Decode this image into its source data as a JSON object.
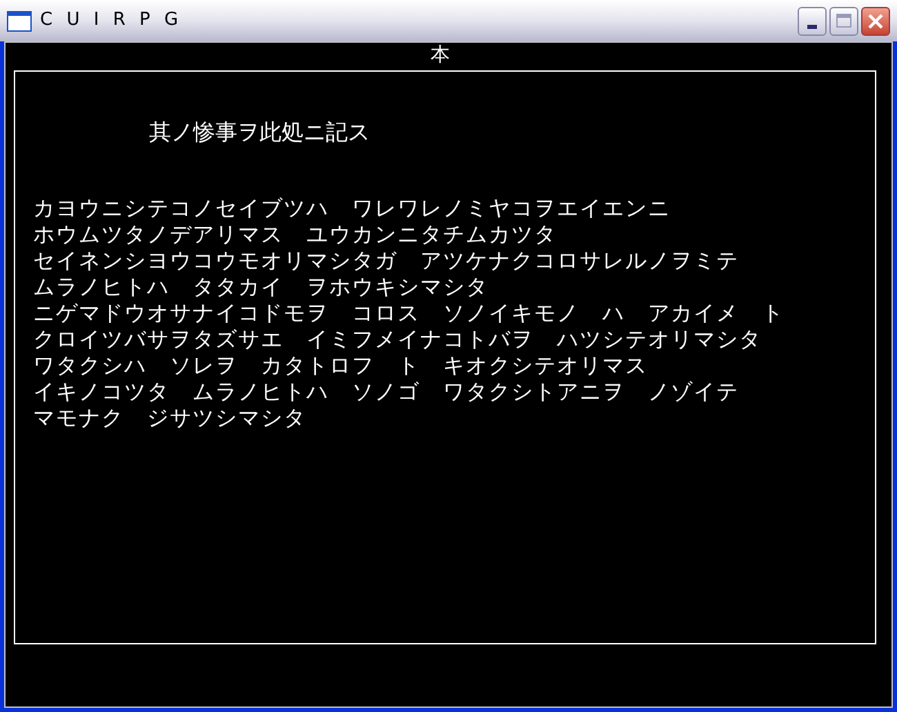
{
  "window": {
    "title": "C U I R P G"
  },
  "header_text": "本",
  "dialog": {
    "heading": "其ノ惨事ヲ此処ニ記ス",
    "lines": [
      "カヨウニシテコノセイブツハ　ワレワレノミヤコヲエイエンニ",
      "ホウムツタノデアリマス　ユウカンニタチムカツタ",
      "セイネンシヨウコウモオリマシタガ　アツケナクコロサレルノヲミテ",
      "ムラノヒトハ　タタカイ　ヲホウキシマシタ",
      "ニゲマドウオサナイコドモヲ　コロス　ソノイキモノ　ハ　アカイメ　ト",
      "クロイツバサヲタズサエ　イミフメイナコトバヲ　ハツシテオリマシタ",
      "ワタクシハ　ソレヲ　カタトロフ　ト　キオクシテオリマス",
      "イキノコツタ　ムラノヒトハ　ソノゴ　ワタクシトアニヲ　ノゾイテ",
      "マモナク　ジサツシマシタ"
    ]
  }
}
